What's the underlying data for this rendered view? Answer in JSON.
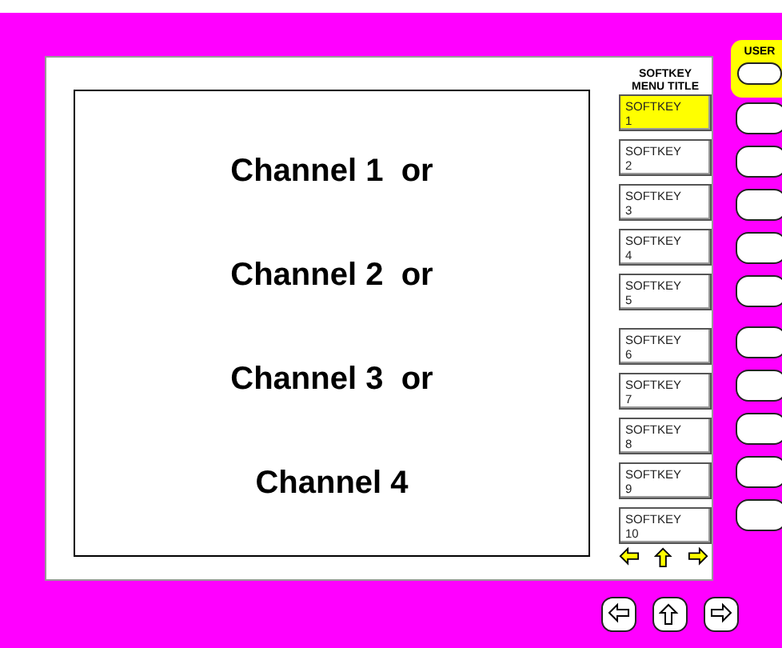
{
  "display": {
    "lines": [
      "Channel 1  or",
      "Channel 2  or",
      "Channel 3  or",
      "Channel 4"
    ]
  },
  "softkey_menu": {
    "title": "SOFTKEY\nMENU TITLE",
    "softkeys": [
      {
        "label": "SOFTKEY\n1",
        "selected": true
      },
      {
        "label": "SOFTKEY\n2",
        "selected": false
      },
      {
        "label": "SOFTKEY\n3",
        "selected": false
      },
      {
        "label": "SOFTKEY\n4",
        "selected": false
      },
      {
        "label": "SOFTKEY\n5",
        "selected": false
      },
      {
        "label": "SOFTKEY\n6",
        "selected": false
      },
      {
        "label": "SOFTKEY\n7",
        "selected": false
      },
      {
        "label": "SOFTKEY\n8",
        "selected": false
      },
      {
        "label": "SOFTKEY\n9",
        "selected": false
      },
      {
        "label": "SOFTKEY\n10",
        "selected": false
      }
    ]
  },
  "hardkeys": {
    "user": {
      "label": "USER",
      "selected": true
    }
  }
}
